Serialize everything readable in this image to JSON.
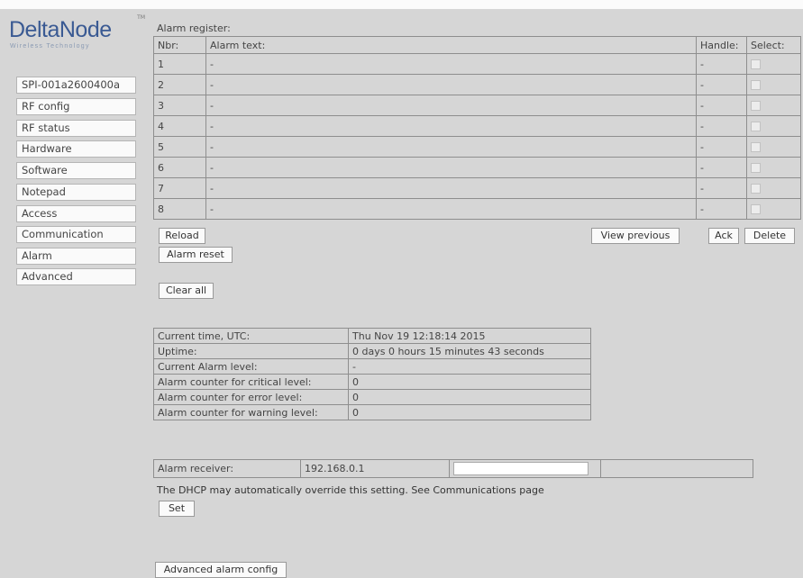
{
  "logo": {
    "name": "DeltaNode",
    "tagline": "Wireless Technology",
    "tm": "TM"
  },
  "sidebar": {
    "items": [
      {
        "label": "SPI-001a2600400a"
      },
      {
        "label": "RF config"
      },
      {
        "label": "RF status"
      },
      {
        "label": "Hardware"
      },
      {
        "label": "Software"
      },
      {
        "label": "Notepad"
      },
      {
        "label": "Access"
      },
      {
        "label": "Communication"
      },
      {
        "label": "Alarm"
      },
      {
        "label": "Advanced"
      }
    ]
  },
  "register": {
    "title": "Alarm register:",
    "headers": {
      "nbr": "Nbr:",
      "text": "Alarm text:",
      "handle": "Handle:",
      "select": "Select:"
    },
    "rows": [
      {
        "nbr": "1",
        "text": "-",
        "handle": "-",
        "selected": false
      },
      {
        "nbr": "2",
        "text": "-",
        "handle": "-",
        "selected": false
      },
      {
        "nbr": "3",
        "text": "-",
        "handle": "-",
        "selected": false
      },
      {
        "nbr": "4",
        "text": "-",
        "handle": "-",
        "selected": false
      },
      {
        "nbr": "5",
        "text": "-",
        "handle": "-",
        "selected": false
      },
      {
        "nbr": "6",
        "text": "-",
        "handle": "-",
        "selected": false
      },
      {
        "nbr": "7",
        "text": "-",
        "handle": "-",
        "selected": false
      },
      {
        "nbr": "8",
        "text": "-",
        "handle": "-",
        "selected": false
      }
    ]
  },
  "actions": {
    "reload": "Reload",
    "view_previous": "View previous",
    "ack": "Ack",
    "delete": "Delete",
    "alarm_reset": "Alarm reset",
    "clear_all": "Clear all"
  },
  "status": {
    "rows": [
      {
        "label": "Current time, UTC:",
        "value": "Thu Nov 19 12:18:14 2015"
      },
      {
        "label": "Uptime:",
        "value": "0 days 0 hours 15 minutes 43 seconds"
      },
      {
        "label": "Current Alarm level:",
        "value": "-"
      },
      {
        "label": "Alarm counter for critical level:",
        "value": "0"
      },
      {
        "label": "Alarm counter for error level:",
        "value": "0"
      },
      {
        "label": "Alarm counter for warning level:",
        "value": "0"
      }
    ]
  },
  "receiver": {
    "label": "Alarm receiver:",
    "value": "192.168.0.1",
    "input_value": "",
    "note": "The DHCP may automatically override this setting. See Communications page",
    "set": "Set"
  },
  "advanced": {
    "label": "Advanced alarm config"
  }
}
